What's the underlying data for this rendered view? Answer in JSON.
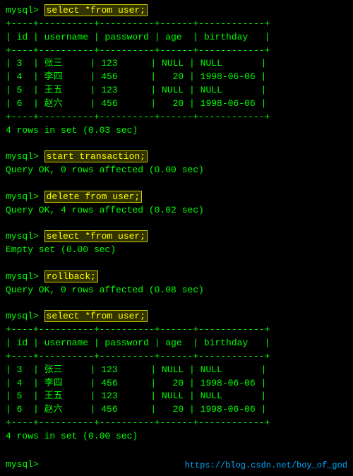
{
  "terminal": {
    "prompt": "mysql>",
    "commands": [
      {
        "id": "cmd1",
        "text": "select *from user;"
      },
      {
        "id": "cmd2",
        "text": "start transaction;"
      },
      {
        "id": "cmd3",
        "text": "delete from user;"
      },
      {
        "id": "cmd4",
        "text": "select *from user;"
      },
      {
        "id": "cmd5",
        "text": "rollback;"
      },
      {
        "id": "cmd6",
        "text": "select *from user;"
      }
    ],
    "table": {
      "separator": "+----+----------+----------+------+------------+",
      "header": "| id | username | password | age  | birthday   |",
      "rows": [
        "| 3  | 张三     | 123      | NULL | NULL       |",
        "| 4  | 李四     | 456      |   20 | 1998-06-06 |",
        "| 5  | 王五     | 123      | NULL | NULL       |",
        "| 6  | 赵六     | 456      |   20 | 1998-06-06 |"
      ]
    },
    "results": {
      "rows4_003": "4 rows in set (0.03 sec)",
      "query_ok_0_000": "Query OK, 0 rows affected (0.00 sec)",
      "query_ok_4_002": "Query OK, 4 rows affected (0.02 sec)",
      "empty_000": "Empty set (0.00 sec)",
      "query_ok_0_008": "Query OK, 0 rows affected (0.08 sec)",
      "rows4_000": "4 rows in set (0.00 sec)"
    },
    "url": "https://blog.csdn.net/boy_of_god"
  }
}
